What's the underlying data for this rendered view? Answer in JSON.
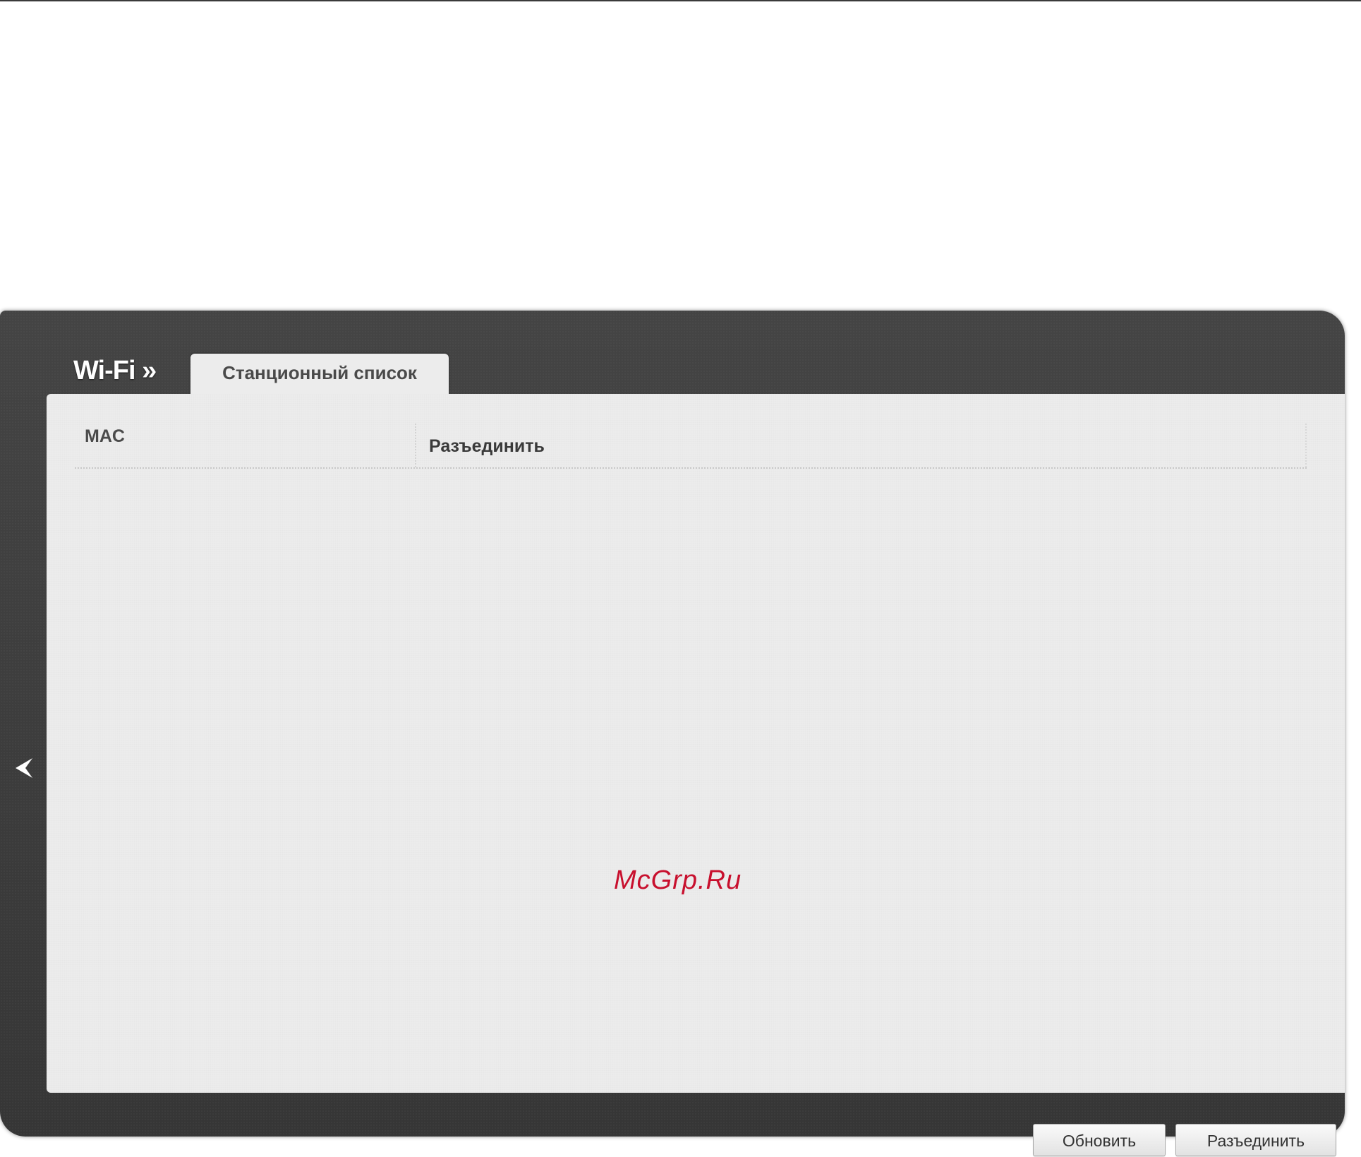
{
  "header": {
    "section_title": "Wi-Fi »",
    "active_tab": "Станционный список"
  },
  "table": {
    "columns": [
      "MAC",
      "Разъединить"
    ],
    "rows": []
  },
  "watermark": "McGrp.Ru",
  "buttons": {
    "refresh_label": "Обновить",
    "disconnect_label": "Разъединить"
  },
  "icons": {
    "back": "chevron-left-icon"
  },
  "colors": {
    "frame": "#3c3c3c",
    "panel": "#ececec",
    "watermark": "#c8102e"
  }
}
